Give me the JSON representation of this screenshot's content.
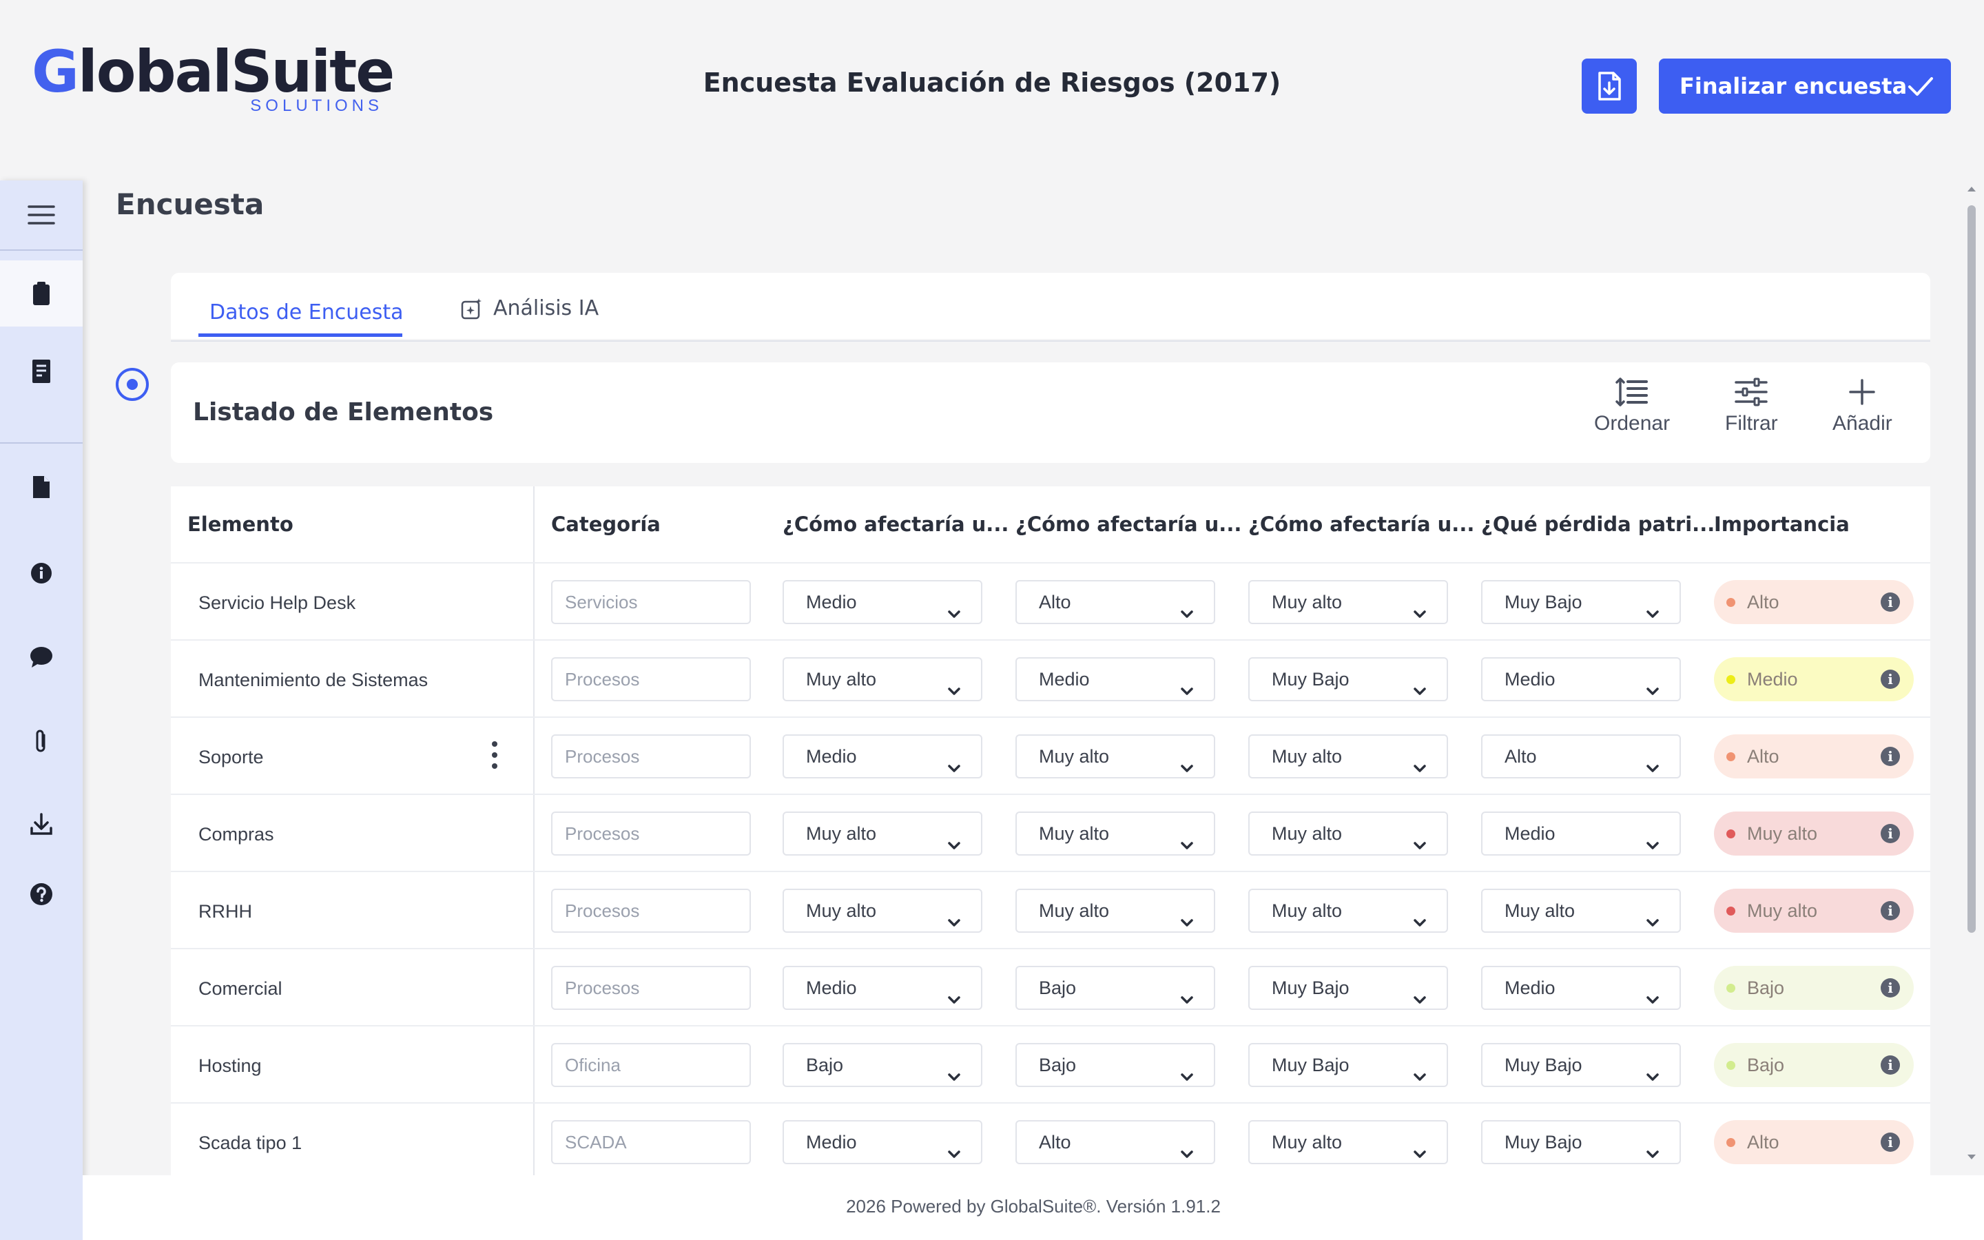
{
  "brand": {
    "name_first": "G",
    "name_rest": "lobalSuite",
    "subtitle": "SOLUTIONS"
  },
  "header": {
    "title": "Encuesta Evaluación de Riesgos (2017)",
    "finish_label": "Finalizar encuesta"
  },
  "sidebar": {
    "items": [
      "menu-icon",
      "clipboard-icon",
      "report-icon",
      "document-icon",
      "info-icon",
      "chat-icon",
      "paperclip-icon",
      "download-icon",
      "help-icon"
    ],
    "active": "clipboard-icon"
  },
  "page": {
    "title": "Encuesta"
  },
  "tabs": [
    {
      "label": "Datos de Encuesta",
      "active": true
    },
    {
      "label": "Análisis IA",
      "active": false
    }
  ],
  "list": {
    "title": "Listado de Elementos",
    "tools": {
      "sort": "Ordenar",
      "filter": "Filtrar",
      "add": "Añadir"
    }
  },
  "table": {
    "headers": [
      "Elemento",
      "Categoría",
      "¿Cómo afectaría u...",
      "¿Cómo afectaría u...",
      "¿Cómo afectaría u...",
      "¿Qué pérdida patri...",
      "Importancia"
    ],
    "rows": [
      {
        "name": "Servicio Help Desk",
        "category": "Servicios",
        "q1": "Medio",
        "q2": "Alto",
        "q3": "Muy alto",
        "q4": "Muy Bajo",
        "importance": "Alto"
      },
      {
        "name": "Mantenimiento de Sistemas",
        "category": "Procesos",
        "q1": "Muy alto",
        "q2": "Medio",
        "q3": "Muy Bajo",
        "q4": "Medio",
        "importance": "Medio"
      },
      {
        "name": "Soporte",
        "category": "Procesos",
        "q1": "Medio",
        "q2": "Muy alto",
        "q3": "Muy alto",
        "q4": "Alto",
        "importance": "Alto"
      },
      {
        "name": "Compras",
        "category": "Procesos",
        "q1": "Muy alto",
        "q2": "Muy alto",
        "q3": "Muy alto",
        "q4": "Medio",
        "importance": "Muy alto"
      },
      {
        "name": "RRHH",
        "category": "Procesos",
        "q1": "Muy alto",
        "q2": "Muy alto",
        "q3": "Muy alto",
        "q4": "Muy alto",
        "importance": "Muy alto"
      },
      {
        "name": "Comercial",
        "category": "Procesos",
        "q1": "Medio",
        "q2": "Bajo",
        "q3": "Muy Bajo",
        "q4": "Medio",
        "importance": "Bajo"
      },
      {
        "name": "Hosting",
        "category": "Oficina",
        "q1": "Bajo",
        "q2": "Bajo",
        "q3": "Muy Bajo",
        "q4": "Muy Bajo",
        "importance": "Bajo"
      },
      {
        "name": "Scada tipo 1",
        "category": "SCADA",
        "q1": "Medio",
        "q2": "Alto",
        "q3": "Muy alto",
        "q4": "Muy Bajo",
        "importance": "Alto"
      }
    ]
  },
  "importance_colors": {
    "Muy alto": {
      "bg": "#f8dada",
      "dot": "#e05a5a"
    },
    "Alto": {
      "bg": "#fde9e2",
      "dot": "#f09372"
    },
    "Medio": {
      "bg": "#fbfbc2",
      "dot": "#ecec18"
    },
    "Bajo": {
      "bg": "#f4f8e4",
      "dot": "#d2ec8e"
    }
  },
  "footer": {
    "text": "2026 Powered by GlobalSuite®. Versión 1.91.2"
  },
  "colors": {
    "accent": "#3d5ef2",
    "sidebar": "#e0e6fa"
  }
}
